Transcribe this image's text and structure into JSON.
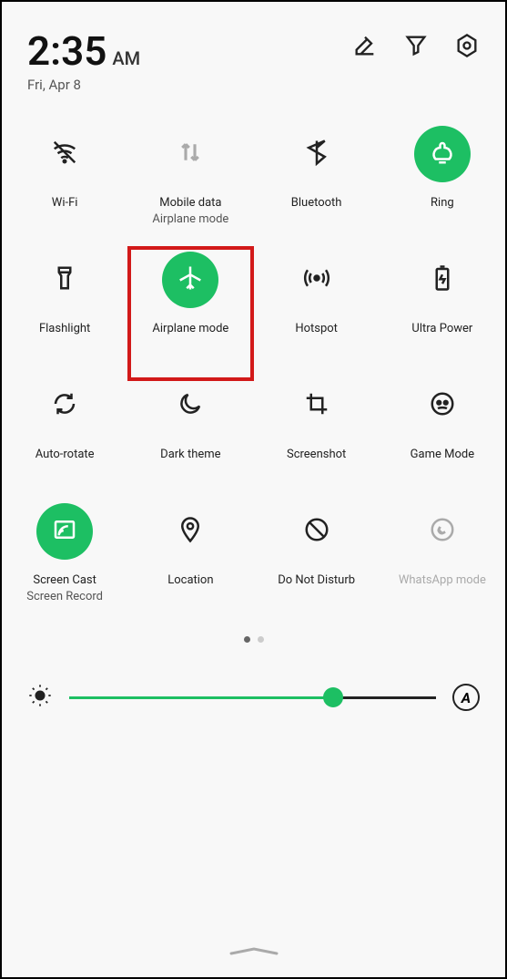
{
  "header": {
    "time": "2:35",
    "ampm": "AM",
    "date": "Fri, Apr 8"
  },
  "tiles": {
    "wifi": {
      "label": "Wi-Fi"
    },
    "mobile_data": {
      "label": "Mobile data",
      "sub": "Airplane mode"
    },
    "bluetooth": {
      "label": "Bluetooth"
    },
    "ring": {
      "label": "Ring"
    },
    "flashlight": {
      "label": "Flashlight"
    },
    "airplane": {
      "label": "Airplane mode"
    },
    "hotspot": {
      "label": "Hotspot"
    },
    "ultra_power": {
      "label": "Ultra Power"
    },
    "auto_rotate": {
      "label": "Auto-rotate"
    },
    "dark_theme": {
      "label": "Dark theme"
    },
    "screenshot": {
      "label": "Screenshot"
    },
    "game_mode": {
      "label": "Game Mode"
    },
    "screen_cast": {
      "label": "Screen Cast",
      "sub": "Screen Record"
    },
    "location": {
      "label": "Location"
    },
    "dnd": {
      "label": "Do Not Disturb"
    },
    "whatsapp": {
      "label": "WhatsApp mode"
    }
  },
  "brightness": {
    "auto": "A",
    "level": 72
  },
  "colors": {
    "accent": "#1dbf63",
    "highlight": "#d21919"
  }
}
